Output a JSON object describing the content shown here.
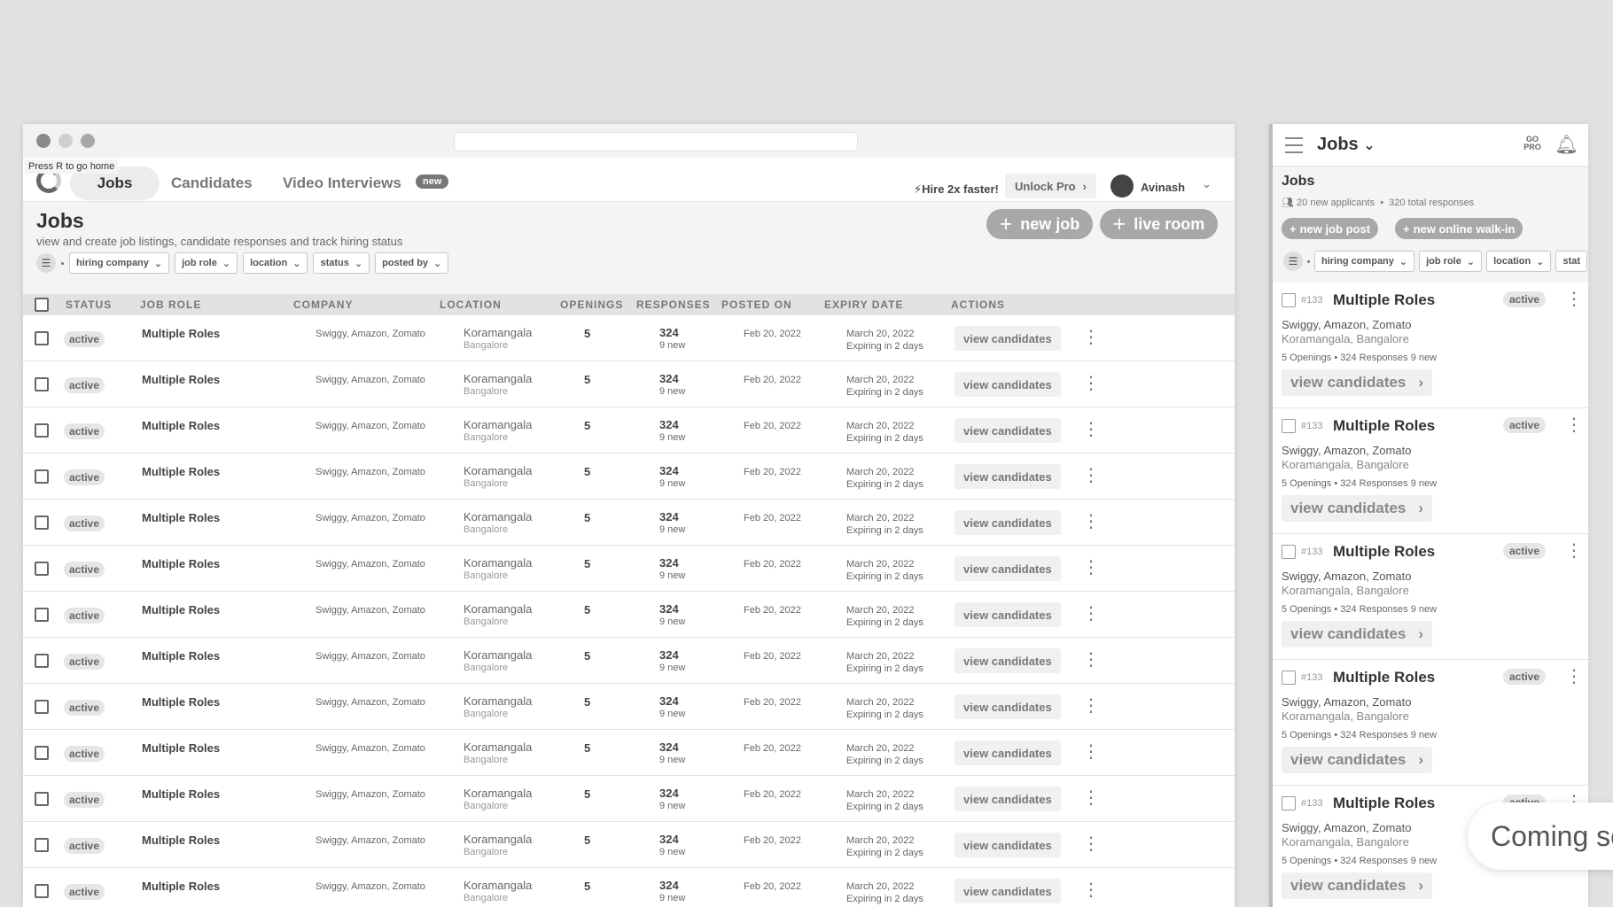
{
  "tooltip": "Press R to go home",
  "nav": {
    "tabs": [
      "Jobs",
      "Candidates",
      "Video Interviews"
    ],
    "badge": "new",
    "hire": "Hire 2x faster!",
    "unlock": "Unlock Pro",
    "user": "Avinash"
  },
  "page": {
    "title": "Jobs",
    "subtitle": "view and create job listings, candidate responses and track hiring status",
    "new_job": "new job",
    "live_room": "live room",
    "filters": [
      "hiring company",
      "job role",
      "location",
      "status",
      "posted by"
    ]
  },
  "table": {
    "headers": [
      "STATUS",
      "JOB ROLE",
      "COMPANY",
      "LOCATION",
      "OPENINGS",
      "RESPONSES",
      "POSTED ON",
      "EXPIRY DATE",
      "ACTIONS"
    ],
    "row": {
      "status": "active",
      "role": "Multiple Roles",
      "company": "Swiggy, Amazon, Zomato",
      "location": "Koramangala",
      "city": "Bangalore",
      "openings": "5",
      "responses": "324",
      "new": "9 new",
      "posted": "Feb 20, 2022",
      "expiry": "March 20, 2022",
      "expiring": "Expiring in 2 days",
      "action": "view candidates"
    },
    "row_count": 13
  },
  "mobile": {
    "title": "Jobs",
    "pro": "GO PRO",
    "head": "Jobs",
    "applicants": "20 new applicants",
    "total": "320 total responses",
    "btn1": "new job post",
    "btn2": "new online walk-in",
    "filters": [
      "hiring company",
      "job role",
      "location",
      "stat"
    ],
    "card": {
      "id": "#133",
      "role": "Multiple Roles",
      "status": "active",
      "company": "Swiggy, Amazon, Zomato",
      "location": "Koramangala, Bangalore",
      "stats": "5 Openings  •  324 Responses  9 new",
      "action": "view candidates"
    },
    "card_count": 5
  },
  "coming_soon": "Coming soon"
}
